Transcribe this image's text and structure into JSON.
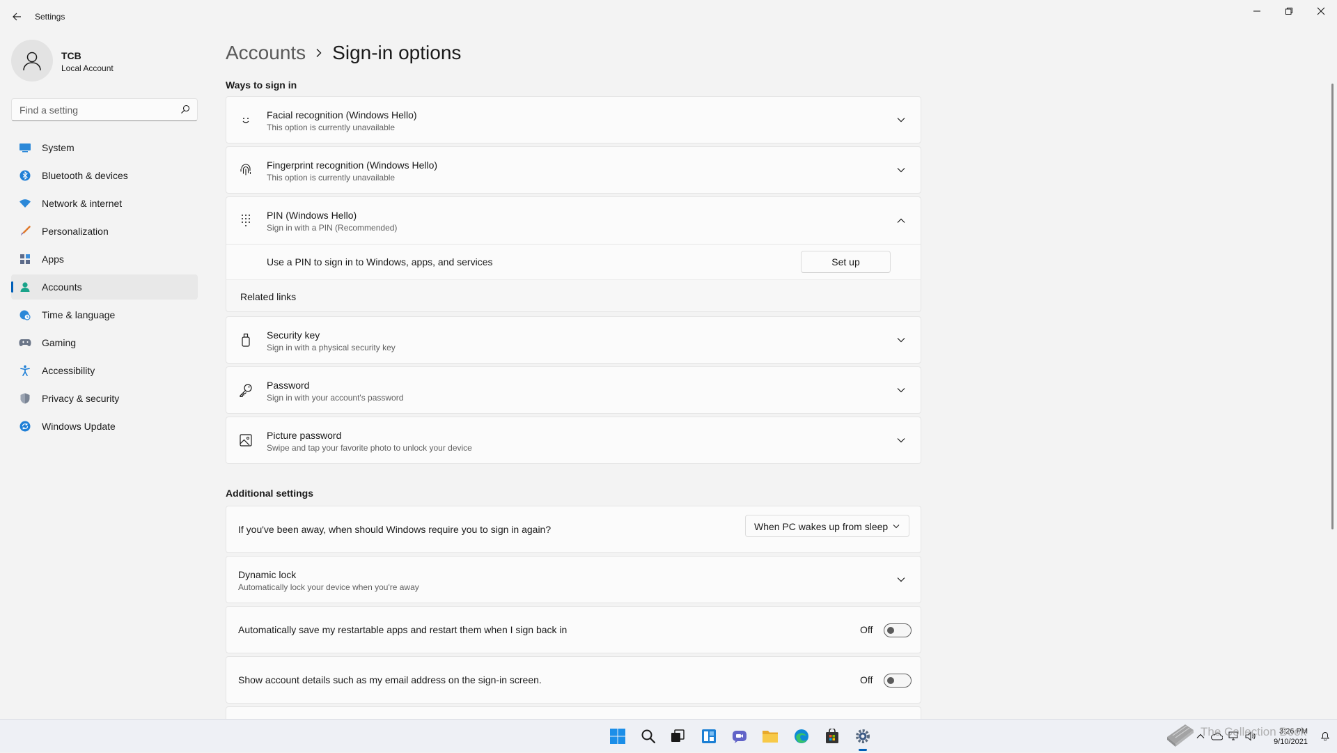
{
  "window": {
    "title": "Settings",
    "controls": [
      "minimize-icon",
      "restore-icon",
      "close-icon"
    ]
  },
  "profile": {
    "name": "TCB",
    "account_type": "Local Account"
  },
  "search": {
    "placeholder": "Find a setting"
  },
  "sidebar": {
    "items": [
      {
        "label": "System",
        "icon": "system-icon",
        "active": false
      },
      {
        "label": "Bluetooth & devices",
        "icon": "bluetooth-icon",
        "active": false
      },
      {
        "label": "Network & internet",
        "icon": "wifi-icon",
        "active": false
      },
      {
        "label": "Personalization",
        "icon": "brush-icon",
        "active": false
      },
      {
        "label": "Apps",
        "icon": "apps-icon",
        "active": false
      },
      {
        "label": "Accounts",
        "icon": "accounts-icon",
        "active": true
      },
      {
        "label": "Time & language",
        "icon": "globe-clock-icon",
        "active": false
      },
      {
        "label": "Gaming",
        "icon": "gamepad-icon",
        "active": false
      },
      {
        "label": "Accessibility",
        "icon": "accessibility-icon",
        "active": false
      },
      {
        "label": "Privacy & security",
        "icon": "shield-icon",
        "active": false
      },
      {
        "label": "Windows Update",
        "icon": "update-icon",
        "active": false
      }
    ]
  },
  "breadcrumb": {
    "parent": "Accounts",
    "current": "Sign-in options"
  },
  "ways_to_sign_in": {
    "heading": "Ways to sign in",
    "options": [
      {
        "title": "Facial recognition (Windows Hello)",
        "subtitle": "This option is currently unavailable",
        "icon": "face-icon",
        "expanded": false
      },
      {
        "title": "Fingerprint recognition (Windows Hello)",
        "subtitle": "This option is currently unavailable",
        "icon": "fingerprint-icon",
        "expanded": false
      },
      {
        "title": "PIN (Windows Hello)",
        "subtitle": "Sign in with a PIN (Recommended)",
        "icon": "pin-keypad-icon",
        "expanded": true
      },
      {
        "title": "Security key",
        "subtitle": "Sign in with a physical security key",
        "icon": "usb-key-icon",
        "expanded": false
      },
      {
        "title": "Password",
        "subtitle": "Sign in with your account's password",
        "icon": "key-icon",
        "expanded": false
      },
      {
        "title": "Picture password",
        "subtitle": "Swipe and tap your favorite photo to unlock your device",
        "icon": "picture-icon",
        "expanded": false
      }
    ],
    "pin_detail": {
      "text": "Use a PIN to sign in to Windows, apps, and services",
      "button": "Set up",
      "related_links": "Related links"
    }
  },
  "additional_settings": {
    "heading": "Additional settings",
    "sign_in_again": {
      "label": "If you've been away, when should Windows require you to sign in again?",
      "selected": "When PC wakes up from sleep"
    },
    "dynamic_lock": {
      "title": "Dynamic lock",
      "subtitle": "Automatically lock your device when you're away"
    },
    "restart_apps": {
      "label": "Automatically save my restartable apps and restart them when I sign back in",
      "state": "Off"
    },
    "account_details": {
      "label": "Show account details such as my email address on the sign-in screen.",
      "state": "Off"
    }
  },
  "taskbar": {
    "apps": [
      "start-icon",
      "search-icon",
      "task-view-icon",
      "widgets-icon",
      "chat-icon",
      "file-explorer-icon",
      "edge-icon",
      "store-icon",
      "settings-icon"
    ],
    "active_app": "settings-icon",
    "clock": {
      "time": "3:26 PM",
      "date": "9/10/2021"
    }
  },
  "watermark": {
    "text": "The Collection Book"
  },
  "colors": {
    "accent": "#005fb8",
    "background": "#f3f3f3",
    "card": "#fbfbfb"
  }
}
